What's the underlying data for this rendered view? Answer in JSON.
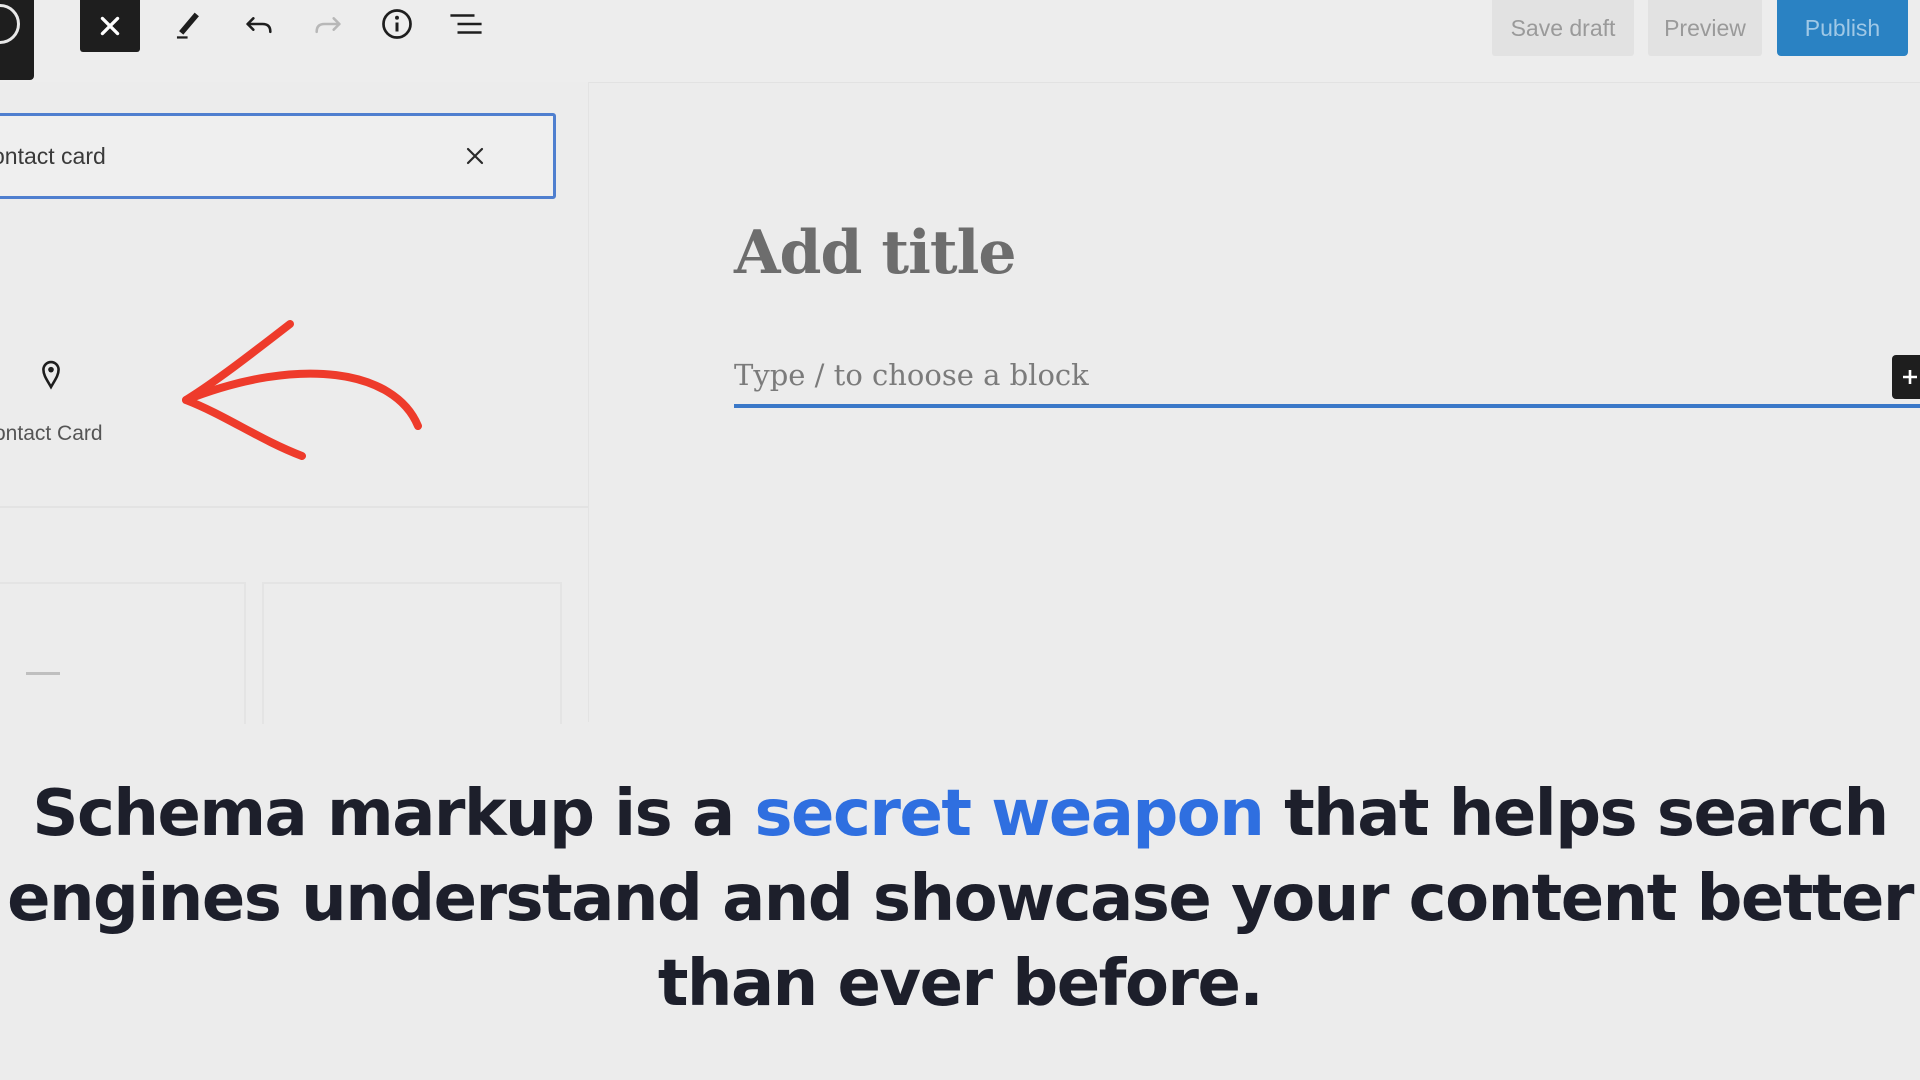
{
  "toolbar": {
    "close_inserter_icon": "close-icon",
    "tools_icon": "pencil-icon",
    "undo_icon": "undo-icon",
    "redo_icon": "redo-icon",
    "details_icon": "info-icon",
    "list_view_icon": "list-view-icon",
    "save_draft_label": "Save draft",
    "preview_label": "Preview",
    "publish_label": "Publish"
  },
  "inserter": {
    "search_value": "ontact card",
    "result_label": "ontact Card",
    "result_icon": "map-pin-icon"
  },
  "editor": {
    "title_placeholder": "Add title",
    "block_placeholder": "Type / to choose a block"
  },
  "caption": {
    "before": "Schema markup is a ",
    "highlight": "secret weapon",
    "after": " that helps search engines understand and showcase your content better than ever before."
  },
  "colors": {
    "publish": "#2a82c3",
    "highlight": "#2f6fe0",
    "annotation_arrow": "#ee3b2b",
    "focus_blue": "#3a78c8"
  }
}
